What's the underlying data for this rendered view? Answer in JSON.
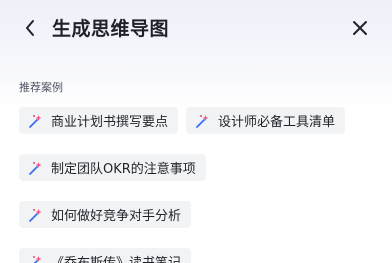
{
  "header": {
    "title": "生成思维导图",
    "back_icon": "chevron-left-icon",
    "close_icon": "close-icon"
  },
  "section": {
    "label": "推荐案例"
  },
  "examples": [
    {
      "label": "商业计划书撰写要点",
      "icon": "magic-wand-icon"
    },
    {
      "label": "设计师必备工具清单",
      "icon": "magic-wand-icon"
    },
    {
      "label": "制定团队OKR的注意事项",
      "icon": "magic-wand-icon"
    },
    {
      "label": "如何做好竞争对手分析",
      "icon": "magic-wand-icon"
    },
    {
      "label": "《乔布斯传》读书笔记",
      "icon": "magic-wand-icon"
    }
  ],
  "colors": {
    "wand_pink": "#f0457a",
    "wand_blue": "#3a6ff2",
    "chip_bg": "#f2f3f5",
    "header_gradient_top": "#eef0f9"
  }
}
